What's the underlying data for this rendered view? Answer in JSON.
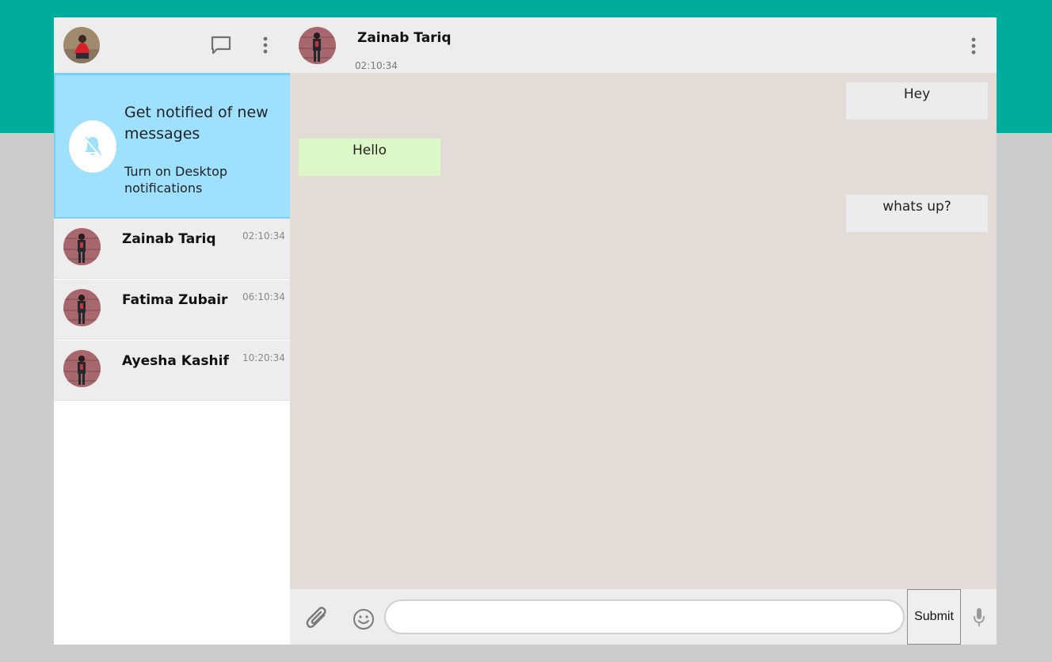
{
  "sidebar": {
    "notification": {
      "title": "Get notified of new messages",
      "subtitle": "Turn on Desktop notifications"
    },
    "contacts": [
      {
        "name": "Zainab Tariq",
        "time": "02:10:34"
      },
      {
        "name": "Fatima Zubair",
        "time": "06:10:34"
      },
      {
        "name": "Ayesha Kashif",
        "time": "10:20:34"
      }
    ]
  },
  "conversation": {
    "header": {
      "name": "Zainab Tariq",
      "time": "02:10:34"
    },
    "messages": [
      {
        "direction": "outgoing",
        "text": "Hey"
      },
      {
        "direction": "incoming",
        "text": "Hello"
      },
      {
        "direction": "outgoing",
        "text": "whats up?"
      }
    ],
    "input": {
      "value": "",
      "placeholder": ""
    },
    "submit_label": "Submit"
  },
  "colors": {
    "brand_band": "#00ad9c",
    "page_background": "#cccccc",
    "notification_background": "#9de1fe",
    "chat_background": "#e3dcd6",
    "incoming_bubble": "#dbf8c6",
    "outgoing_bubble": "#ececec"
  },
  "icons": {
    "new_chat": "chat-bubble-icon",
    "menu": "vertical-dots-icon",
    "notification": "bell-off-icon",
    "attach": "paperclip-icon",
    "emoji": "smiley-icon",
    "voice": "microphone-icon"
  }
}
